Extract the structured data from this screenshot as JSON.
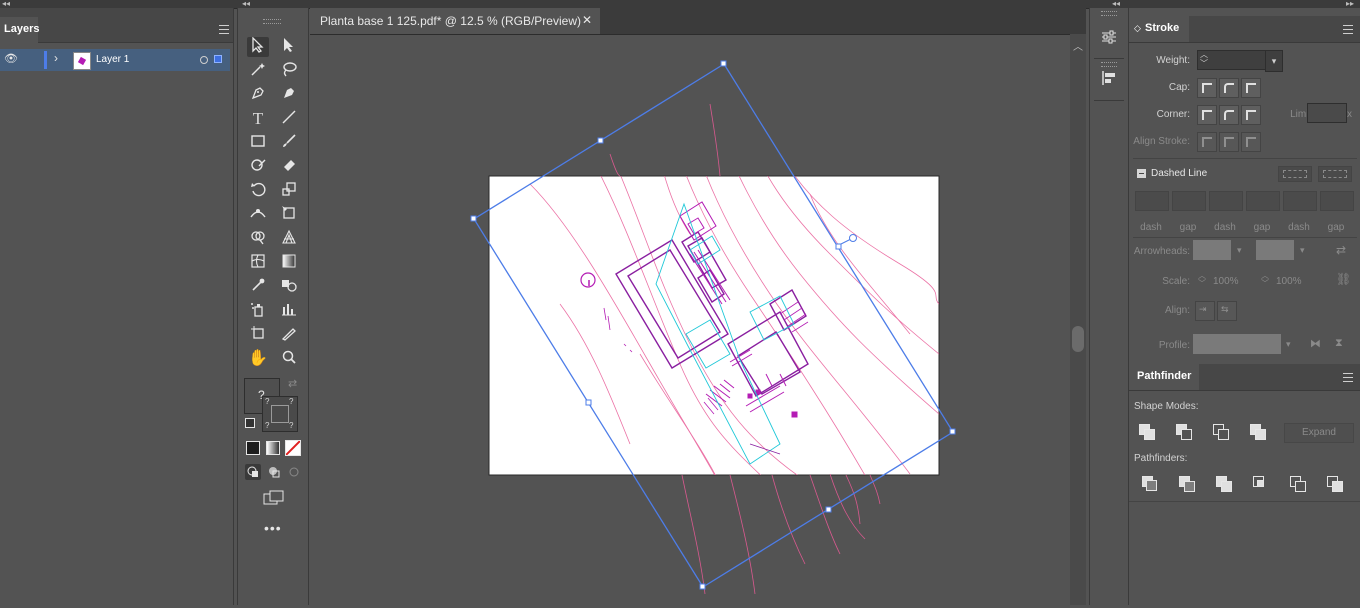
{
  "layers_panel": {
    "tab_label": "Layers",
    "layer_name": "Layer 1"
  },
  "document": {
    "tab_title": "Planta base 1 125.pdf* @ 12.5 % (RGB/Preview)",
    "close_glyph": "✕"
  },
  "stroke_panel": {
    "tab_label": "Stroke",
    "weight_label": "Weight:",
    "cap_label": "Cap:",
    "corner_label": "Corner:",
    "limit_label": "Limit:",
    "limit_suffix": "x",
    "align_stroke_label": "Align Stroke:",
    "dashed_line_label": "Dashed Line",
    "dash_labels": [
      "dash",
      "gap",
      "dash",
      "gap",
      "dash",
      "gap"
    ],
    "arrowheads_label": "Arrowheads:",
    "scale_label": "Scale:",
    "scale_value_1": "100%",
    "scale_value_2": "100%",
    "align_label": "Align:",
    "profile_label": "Profile:"
  },
  "pathfinder_panel": {
    "tab_label": "Pathfinder",
    "shape_modes_label": "Shape Modes:",
    "expand_label": "Expand",
    "pathfinders_label": "Pathfinders:"
  },
  "colors": {
    "selection_blue": "#4d7de8",
    "artwork_magenta": "#b41cb4",
    "artwork_pink": "#e85a96",
    "artwork_cyan": "#20c8d8"
  }
}
